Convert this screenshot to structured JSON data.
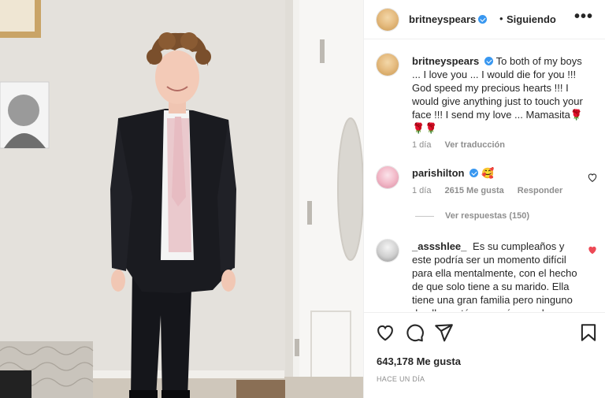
{
  "post": {
    "username": "britneyspears",
    "separator": "•",
    "follow_status": "Siguiendo",
    "more_label": "•••"
  },
  "comments": [
    {
      "username": "britneyspears",
      "text": "To both of my boys ... I love you ... I would die for you !!! God speed my precious hearts !!! I would give anything just to touch your face !!! I send my love ... Mamasita🌹🌹🌹",
      "time": "1 día",
      "translate": "Ver traducción"
    },
    {
      "username": "parishilton",
      "text": "🥰",
      "time": "1 día",
      "likes": "2615 Me gusta",
      "reply": "Responder",
      "view_replies": "Ver respuestas (150)"
    },
    {
      "username": "_assshlee_",
      "text": "Es su cumpleaños y este podría ser un momento difícil para ella mentalmente, con el hecho de que solo tiene a su marido. Ella tiene una gran familia pero ninguno de ellos está por aquí o puede",
      "liked": true
    }
  ],
  "footer": {
    "likes": "643,178 Me gusta",
    "time_ago": "HACE UN DÍA"
  },
  "icons": {
    "like": "heart-icon",
    "comment": "comment-icon",
    "share": "send-icon",
    "save": "bookmark-icon"
  },
  "colors": {
    "verified": "#3897f0",
    "liked_heart": "#ed4956",
    "muted_text": "#8e8e8e"
  }
}
